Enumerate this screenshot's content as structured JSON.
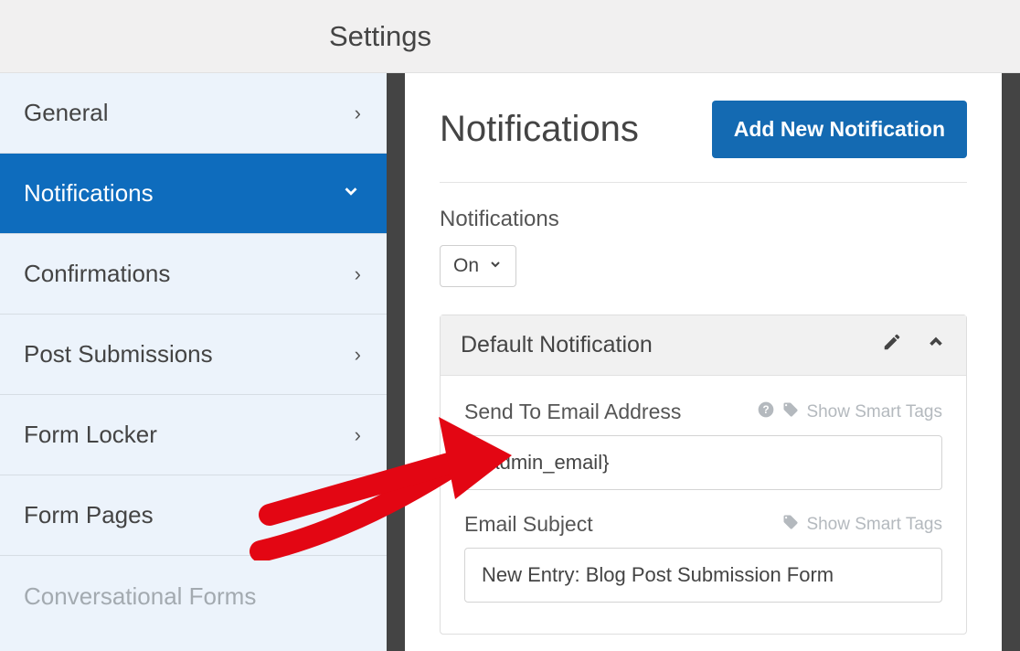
{
  "topbar": {
    "title": "Settings"
  },
  "sidebar": {
    "items": [
      {
        "label": "General"
      },
      {
        "label": "Notifications"
      },
      {
        "label": "Confirmations"
      },
      {
        "label": "Post Submissions"
      },
      {
        "label": "Form Locker"
      },
      {
        "label": "Form Pages"
      },
      {
        "label": "Conversational Forms"
      }
    ]
  },
  "panel": {
    "title": "Notifications",
    "add_button": "Add New Notification",
    "toggle_label": "Notifications",
    "toggle_value": "On"
  },
  "notification": {
    "card_title": "Default Notification",
    "fields": {
      "send_to": {
        "label": "Send To Email Address",
        "value": "{admin_email}",
        "smart_tags": "Show Smart Tags"
      },
      "subject": {
        "label": "Email Subject",
        "value": "New Entry: Blog Post Submission Form",
        "smart_tags": "Show Smart Tags"
      }
    }
  }
}
